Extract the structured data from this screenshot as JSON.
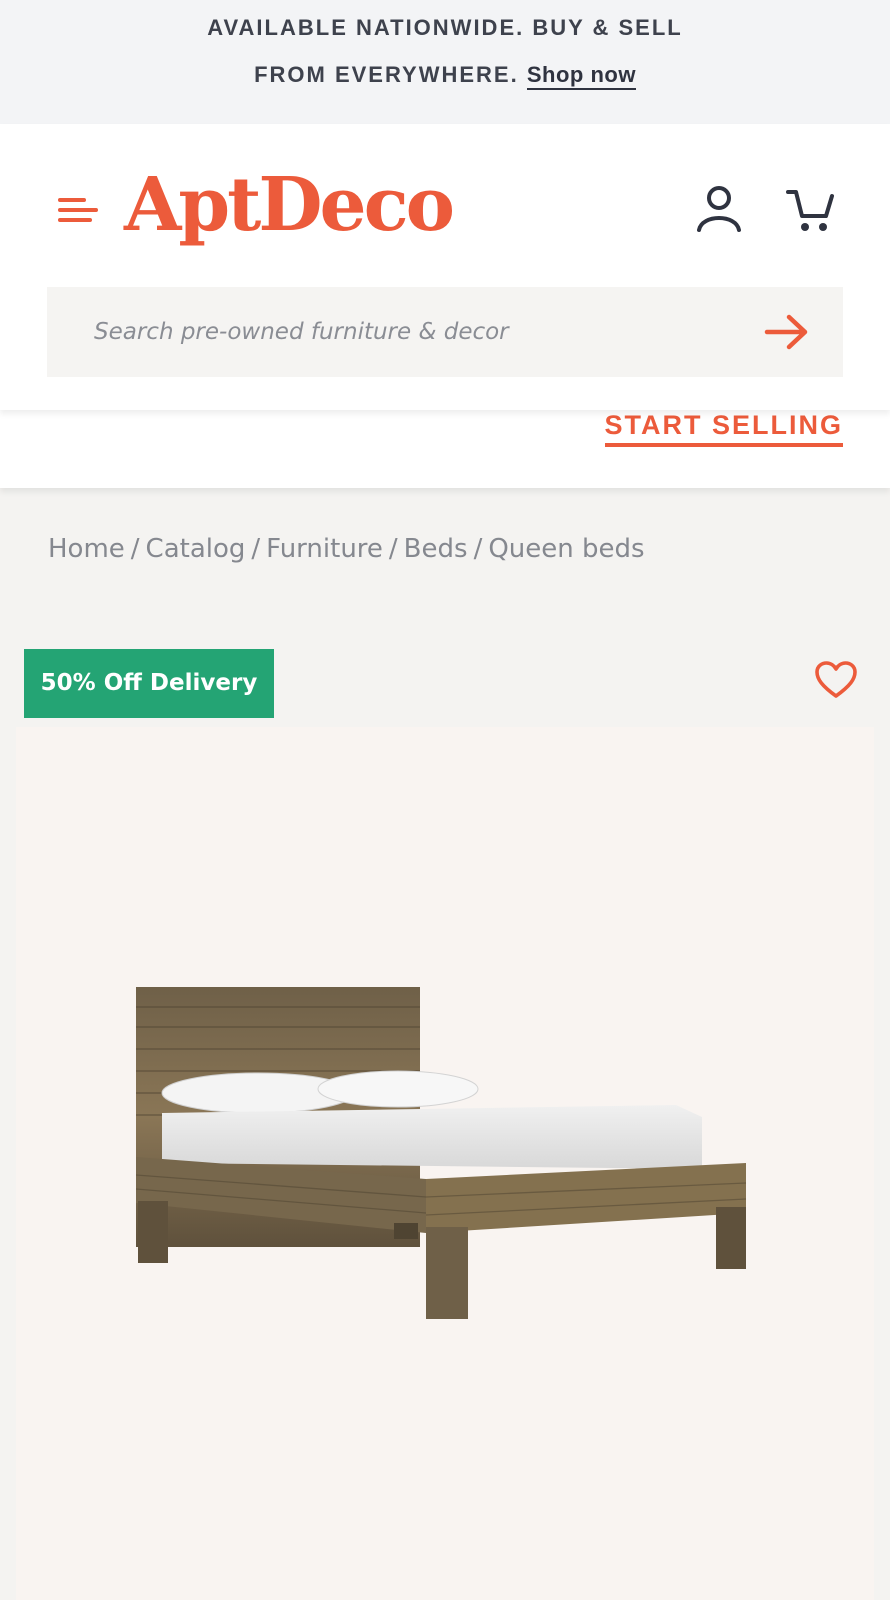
{
  "announcement": {
    "line1": "AVAILABLE NATIONWIDE. BUY & SELL",
    "line2": "FROM EVERYWHERE.",
    "link_label": "Shop now"
  },
  "header": {
    "logo_text": "AptDeco",
    "menu_icon": "hamburger-menu-icon",
    "user_icon": "user-account-icon",
    "cart_icon": "shopping-cart-icon"
  },
  "search": {
    "placeholder": "Search pre-owned furniture & decor",
    "value": "",
    "submit_icon": "arrow-right-icon"
  },
  "sell": {
    "label": "START SELLING"
  },
  "breadcrumb": [
    {
      "label": "Home"
    },
    {
      "label": "Catalog"
    },
    {
      "label": "Furniture"
    },
    {
      "label": "Beds"
    },
    {
      "label": "Queen beds"
    }
  ],
  "product": {
    "badge": "50% Off Delivery",
    "favorite_icon": "heart-icon",
    "image": "reclaimed-wood-queen-bed"
  },
  "colors": {
    "brand": "#ec5b3b",
    "badge_green": "#24a474",
    "text_dark": "#3e424d",
    "text_muted": "#85888f"
  }
}
